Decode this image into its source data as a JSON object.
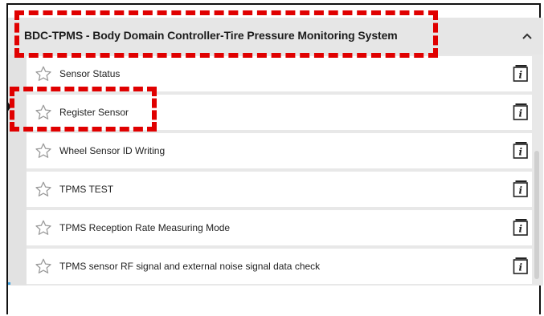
{
  "section": {
    "title": "BDC-TPMS - Body Domain Controller-Tire Pressure Monitoring System",
    "expanded": true
  },
  "items": [
    {
      "label": "Sensor Status",
      "icon": "star-outline-icon",
      "action_icon": "info-icon"
    },
    {
      "label": "Register Sensor",
      "icon": "star-outline-icon",
      "action_icon": "info-icon"
    },
    {
      "label": "Wheel Sensor ID Writing",
      "icon": "star-outline-icon",
      "action_icon": "info-icon"
    },
    {
      "label": "TPMS TEST",
      "icon": "star-outline-icon",
      "action_icon": "info-icon"
    },
    {
      "label": "TPMS Reception Rate Measuring Mode",
      "icon": "star-outline-icon",
      "action_icon": "info-icon"
    },
    {
      "label": "TPMS sensor RF signal and external noise signal data check",
      "icon": "star-outline-icon",
      "action_icon": "info-icon"
    }
  ],
  "colors": {
    "highlight": "#e00000",
    "panel": "#e8e8e8",
    "row": "#ffffff",
    "text": "#222222"
  }
}
